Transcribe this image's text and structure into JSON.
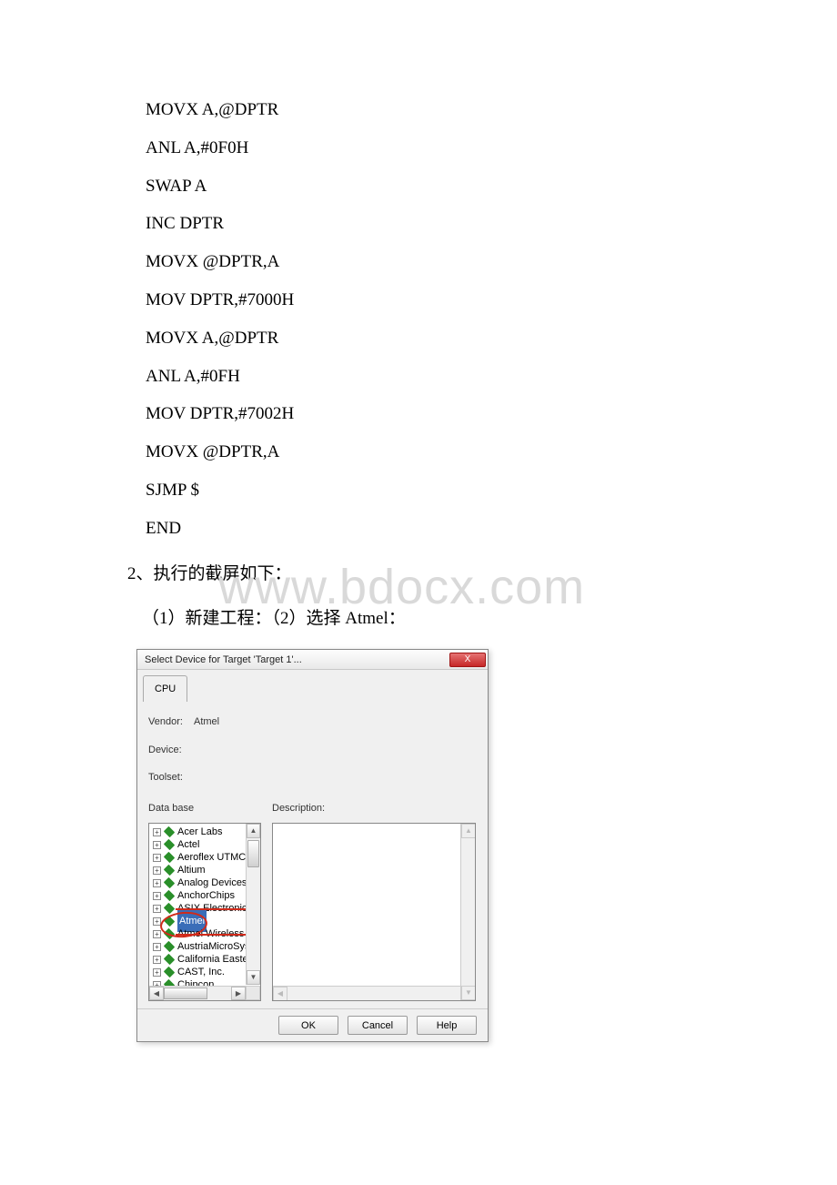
{
  "code": {
    "lines": [
      "MOVX A,@DPTR",
      "ANL A,#0F0H",
      "SWAP A",
      "INC DPTR",
      "MOVX @DPTR,A",
      "MOV DPTR,#7000H",
      "MOVX A,@DPTR",
      "ANL A,#0FH",
      "MOV DPTR,#7002H",
      "MOVX @DPTR,A",
      "SJMP $",
      "END"
    ]
  },
  "text": {
    "section2": "2、执行的截屏如下：",
    "steps": "（1）新建工程：（2）选择 Atmel："
  },
  "watermark": "www.bdocx.com",
  "dialog": {
    "title": "Select Device for Target 'Target 1'...",
    "close": "X",
    "tab": "CPU",
    "vendor_label": "Vendor:",
    "vendor_value": "Atmel",
    "device_label": "Device:",
    "toolset_label": "Toolset:",
    "database_label": "Data base",
    "description_label": "Description:",
    "tree": [
      {
        "label": "Acer Labs",
        "strike": false,
        "selected": false
      },
      {
        "label": "Actel",
        "strike": false,
        "selected": false
      },
      {
        "label": "Aeroflex UTMC",
        "strike": false,
        "selected": false
      },
      {
        "label": "Altium",
        "strike": false,
        "selected": false
      },
      {
        "label": "Analog Devices",
        "strike": false,
        "selected": false
      },
      {
        "label": "AnchorChips",
        "strike": false,
        "selected": false
      },
      {
        "label": "ASIX Electronics Corporat",
        "strike": true,
        "selected": false
      },
      {
        "label": "Atmel",
        "strike": false,
        "selected": true,
        "circled": true
      },
      {
        "label": "Atmel Wireless & uC",
        "strike": true,
        "selected": false
      },
      {
        "label": "AustriaMicroSystems",
        "strike": false,
        "selected": false
      },
      {
        "label": "California Eastern Laborat",
        "strike": false,
        "selected": false
      },
      {
        "label": "CAST, Inc.",
        "strike": false,
        "selected": false
      },
      {
        "label": "Chipcon",
        "strike": false,
        "selected": false
      }
    ],
    "buttons": {
      "ok": "OK",
      "cancel": "Cancel",
      "help": "Help"
    }
  }
}
